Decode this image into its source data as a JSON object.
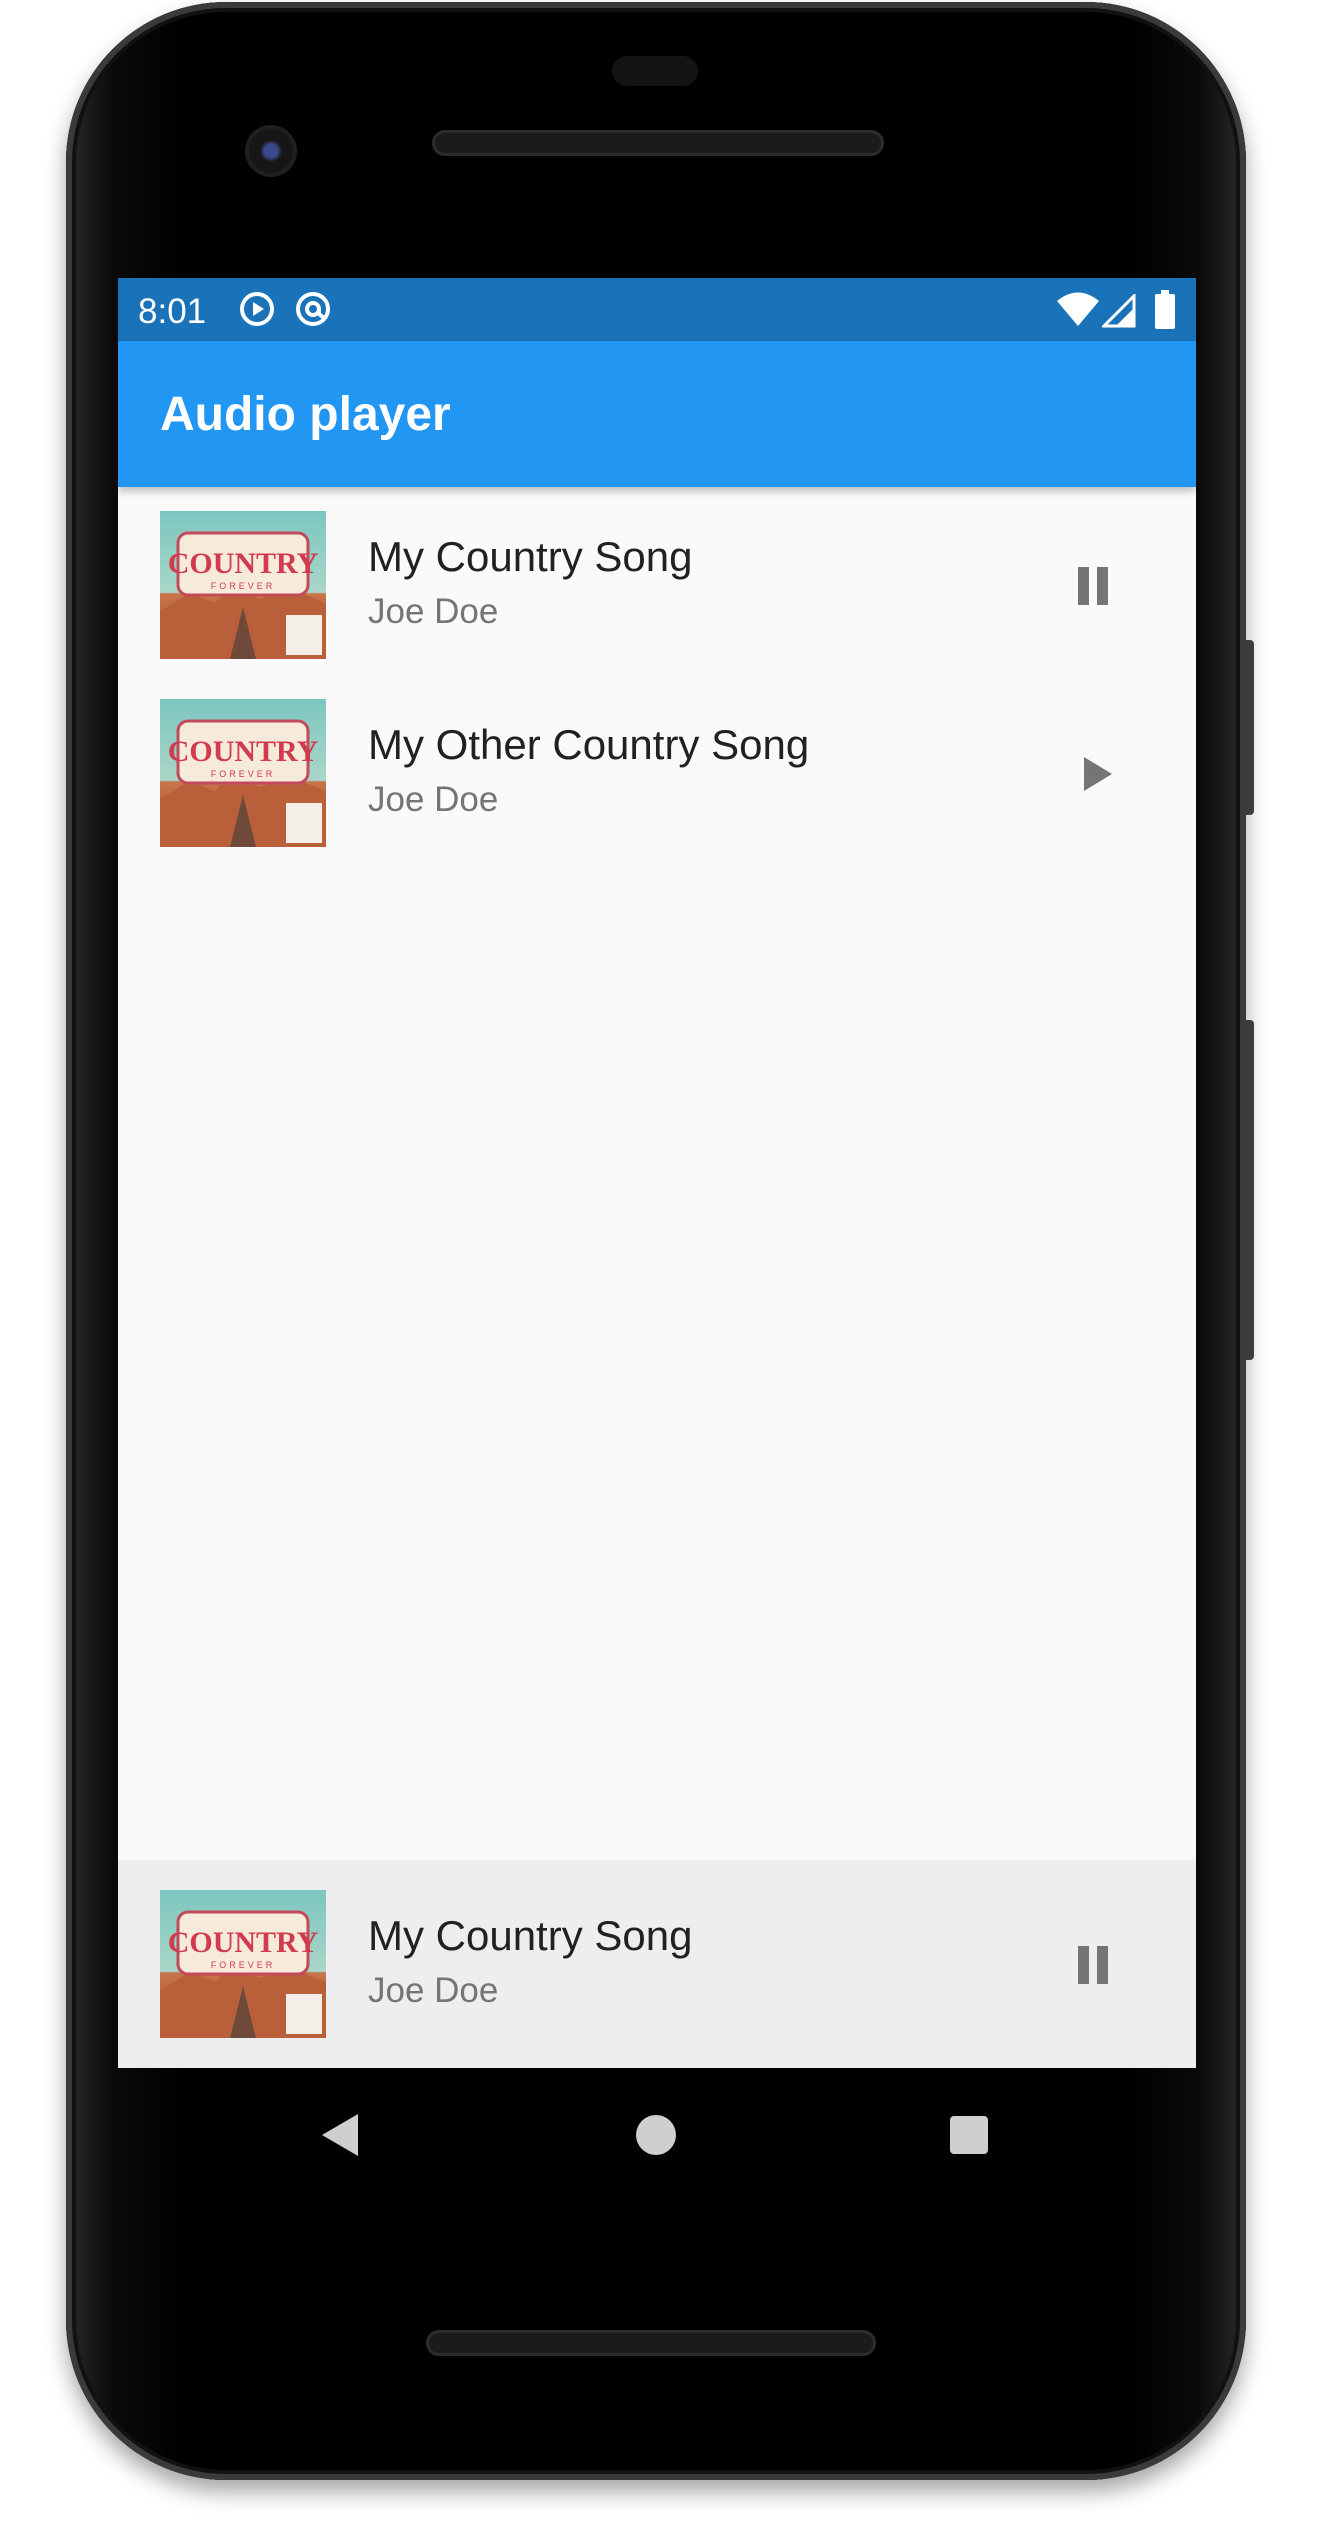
{
  "status_bar": {
    "time": "8:01",
    "left_icons": [
      "play-circle-icon",
      "at-sign-icon"
    ],
    "right_icons": [
      "wifi-icon",
      "cell-signal-icon",
      "battery-icon"
    ],
    "color": "#1a73b9"
  },
  "app_bar": {
    "title": "Audio player",
    "color": "#2196f3"
  },
  "playlist": [
    {
      "title": "My Country Song",
      "artist": "Joe Doe",
      "action": "pause",
      "action_icon": "pause-icon",
      "art_text": "COUNTRY",
      "art_sub": "FOREVER"
    },
    {
      "title": "My Other Country Song",
      "artist": "Joe Doe",
      "action": "play",
      "action_icon": "play-icon",
      "art_text": "COUNTRY",
      "art_sub": "FOREVER"
    }
  ],
  "now_playing": {
    "title": "My Country Song",
    "artist": "Joe Doe",
    "action": "pause",
    "action_icon": "pause-icon",
    "art_text": "COUNTRY",
    "art_sub": "FOREVER"
  },
  "nav_bar": {
    "buttons": [
      "back-triangle-icon",
      "home-circle-icon",
      "recents-square-icon"
    ]
  }
}
